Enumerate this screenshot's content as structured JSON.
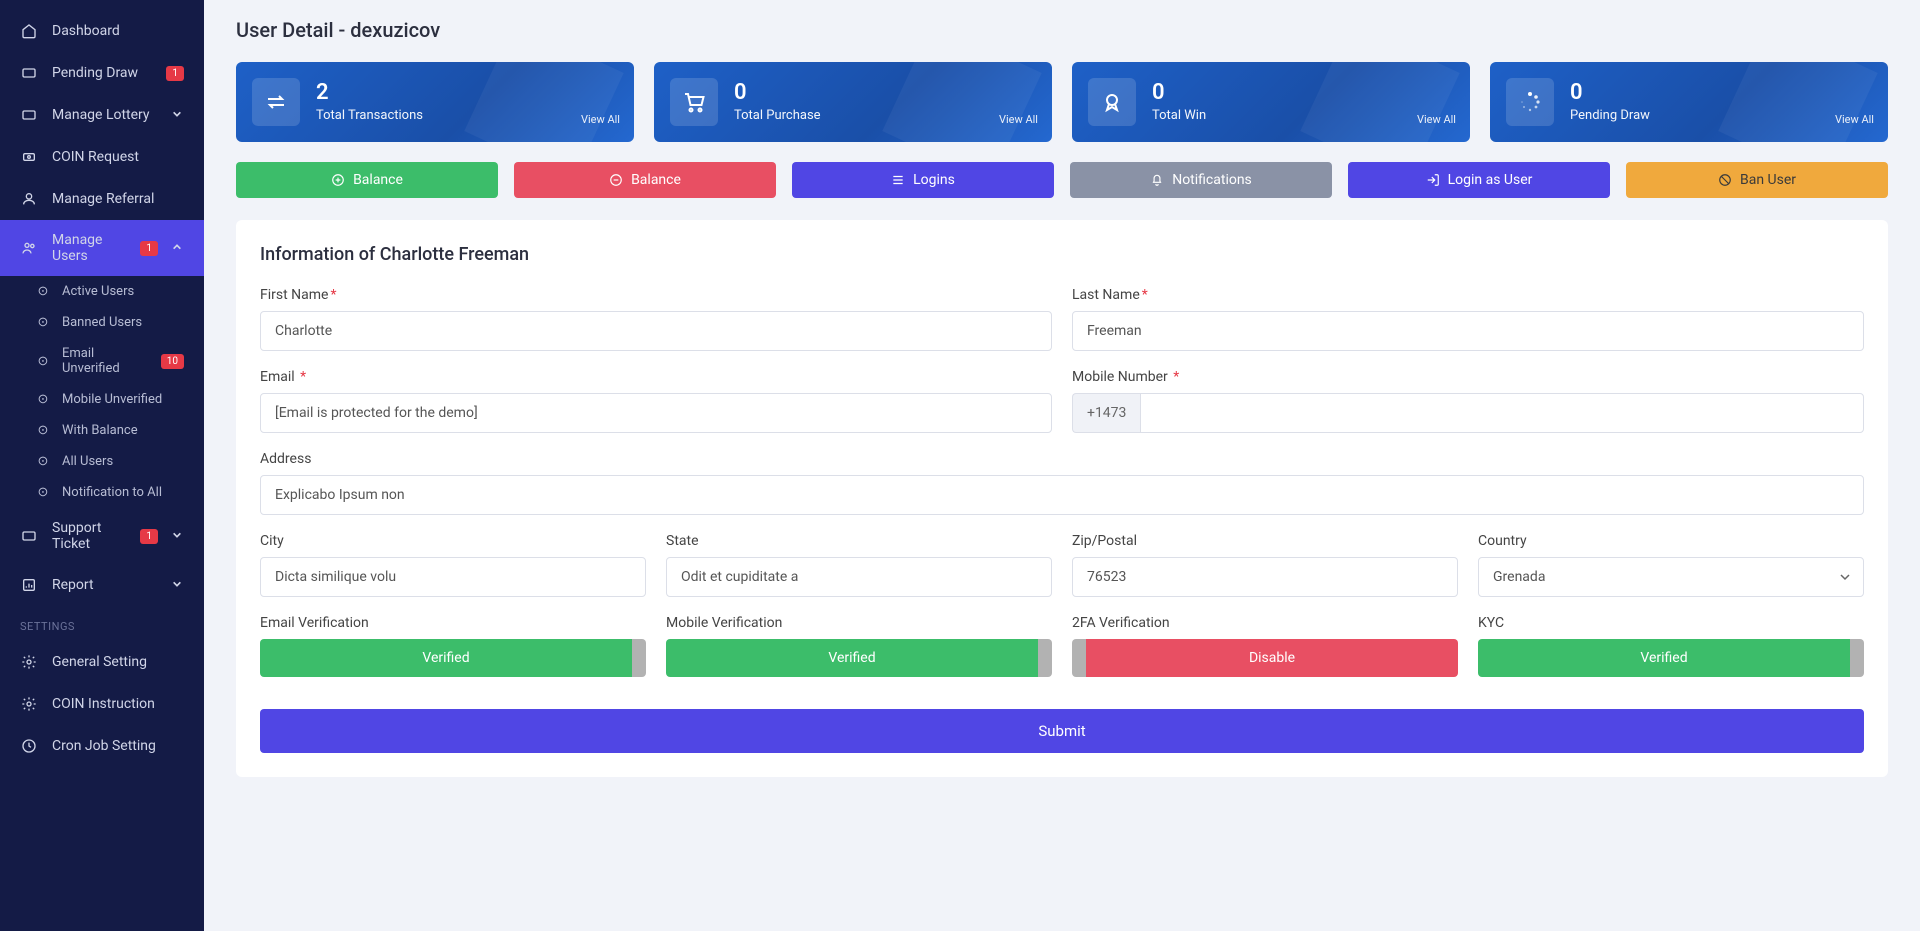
{
  "page_title": "User Detail - dexuzicov",
  "sidebar": {
    "items": [
      {
        "label": "Dashboard",
        "icon": "home"
      },
      {
        "label": "Pending Draw",
        "icon": "ticket",
        "badge": "1"
      },
      {
        "label": "Manage Lottery",
        "icon": "ticket",
        "expand": true
      },
      {
        "label": "COIN Request",
        "icon": "coin"
      },
      {
        "label": "Manage Referral",
        "icon": "user"
      },
      {
        "label": "Manage Users",
        "icon": "users",
        "badge": "1",
        "active": true,
        "expand": true
      },
      {
        "label": "Support Ticket",
        "icon": "ticket",
        "badge": "1",
        "expand": true
      },
      {
        "label": "Report",
        "icon": "report",
        "expand": true
      }
    ],
    "sub_users": [
      {
        "label": "Active Users"
      },
      {
        "label": "Banned Users"
      },
      {
        "label": "Email Unverified",
        "badge": "10"
      },
      {
        "label": "Mobile Unverified"
      },
      {
        "label": "With Balance"
      },
      {
        "label": "All Users"
      },
      {
        "label": "Notification to All"
      }
    ],
    "settings_heading": "SETTINGS",
    "settings": [
      {
        "label": "General Setting",
        "icon": "gear"
      },
      {
        "label": "COIN Instruction",
        "icon": "gear"
      },
      {
        "label": "Cron Job Setting",
        "icon": "clock"
      }
    ]
  },
  "stats": [
    {
      "num": "2",
      "label": "Total Transactions",
      "link": "View All",
      "icon": "arrows"
    },
    {
      "num": "0",
      "label": "Total Purchase",
      "link": "View All",
      "icon": "cart"
    },
    {
      "num": "0",
      "label": "Total Win",
      "link": "View All",
      "icon": "badge"
    },
    {
      "num": "0",
      "label": "Pending Draw",
      "link": "View All",
      "icon": "spinner"
    }
  ],
  "actions": {
    "balance_add": "Balance",
    "balance_sub": "Balance",
    "logins": "Logins",
    "notifications": "Notifications",
    "login_as": "Login as User",
    "ban": "Ban User"
  },
  "info": {
    "title": "Information of Charlotte Freeman",
    "labels": {
      "first_name": "First Name",
      "last_name": "Last Name",
      "email": "Email",
      "mobile": "Mobile Number",
      "address": "Address",
      "city": "City",
      "state": "State",
      "zip": "Zip/Postal",
      "country": "Country",
      "email_ver": "Email Verification",
      "mobile_ver": "Mobile Verification",
      "twofa": "2FA Verification",
      "kyc": "KYC"
    },
    "values": {
      "first_name": "Charlotte",
      "last_name": "Freeman",
      "email": "[Email is protected for the demo]",
      "mobile_prefix": "+1473",
      "mobile": "",
      "address": "Explicabo Ipsum non",
      "city": "Dicta similique volu",
      "state": "Odit et cupiditate a",
      "zip": "76523",
      "country": "Grenada"
    },
    "toggles": {
      "email_ver": {
        "text": "Verified",
        "state": "on"
      },
      "mobile_ver": {
        "text": "Verified",
        "state": "on"
      },
      "twofa": {
        "text": "Disable",
        "state": "off"
      },
      "kyc": {
        "text": "Verified",
        "state": "on"
      }
    },
    "submit": "Submit"
  }
}
